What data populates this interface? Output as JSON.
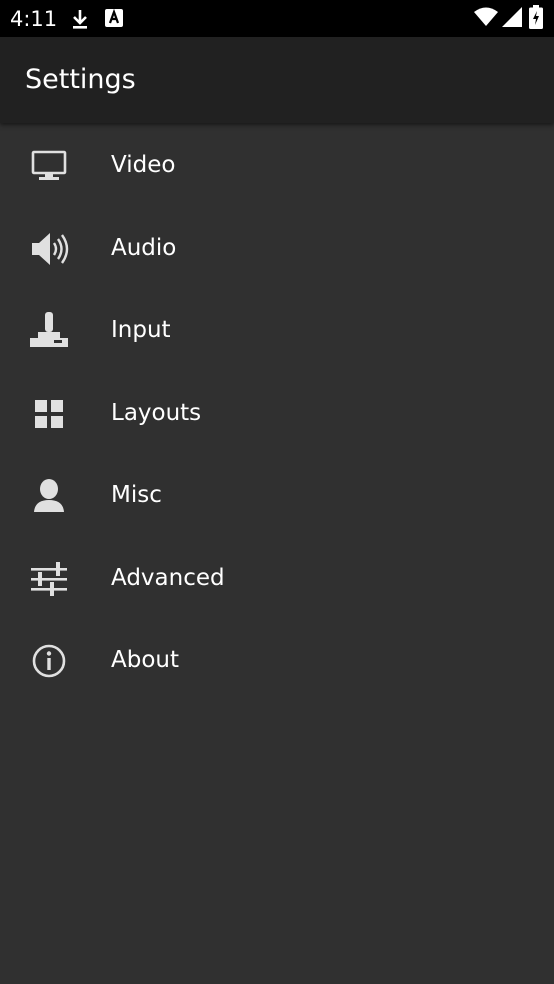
{
  "status_bar": {
    "time": "4:11",
    "icons": [
      "download-icon",
      "a-notification-icon",
      "wifi-icon",
      "signal-icon",
      "battery-icon"
    ]
  },
  "app_bar": {
    "title": "Settings"
  },
  "settings": {
    "items": [
      {
        "label": "Video",
        "icon": "monitor-icon"
      },
      {
        "label": "Audio",
        "icon": "speaker-icon"
      },
      {
        "label": "Input",
        "icon": "joystick-icon"
      },
      {
        "label": "Layouts",
        "icon": "grid-icon"
      },
      {
        "label": "Misc",
        "icon": "person-icon"
      },
      {
        "label": "Advanced",
        "icon": "sliders-icon"
      },
      {
        "label": "About",
        "icon": "info-icon"
      }
    ]
  },
  "colors": {
    "status_bar": "#000000",
    "app_bar": "#212121",
    "background": "#303030",
    "text": "#ffffff",
    "icon": "#e0e0e0"
  }
}
